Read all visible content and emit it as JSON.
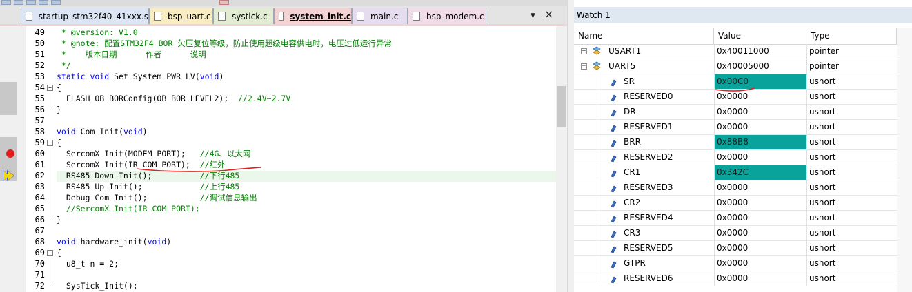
{
  "editor": {
    "tabs": [
      {
        "label": "startup_stm32f40_41xxx.s",
        "color": "#dce5f3"
      },
      {
        "label": "bsp_uart.c",
        "color": "#f7ecc2"
      },
      {
        "label": "systick.c",
        "color": "#e2ecd2"
      },
      {
        "label": "system_init.c",
        "color": "#f2d2d2"
      },
      {
        "label": "main.c",
        "color": "#e5dcf0"
      },
      {
        "label": "bsp_modem.c",
        "color": "#f0dce7"
      }
    ],
    "active_tab_index": 3,
    "menu_glyph": "▼",
    "close_glyph": "×",
    "lines": [
      {
        "num": "49",
        "text": " * @version: V1.0",
        "style": "cmt"
      },
      {
        "num": "50",
        "text": " * @note: 配置STM32F4 BOR 欠压复位等级，防止使用超级电容供电时，电压过低运行异常",
        "style": "cmt"
      },
      {
        "num": "51",
        "text": " *    版本日期      作者      说明",
        "style": "cmt"
      },
      {
        "num": "52",
        "text": " */",
        "style": "cmt"
      },
      {
        "num": "53",
        "pre": "",
        "kw1": "static void",
        "mid": " Set_System_PWR_LV(",
        "kw2": "void",
        "post": ")",
        "style": "kwline"
      },
      {
        "num": "54",
        "text": "{",
        "style": "plain"
      },
      {
        "num": "55",
        "code": "  FLASH_OB_BORConfig(OB_BOR_LEVEL2);  ",
        "comment": "//2.4V~2.7V",
        "style": "mixed"
      },
      {
        "num": "56",
        "text": "}",
        "style": "plain"
      },
      {
        "num": "57",
        "text": "",
        "style": "plain"
      },
      {
        "num": "58",
        "pre": "",
        "kw1": "void",
        "mid": " Com_Init(",
        "kw2": "void",
        "post": ")",
        "style": "kwline"
      },
      {
        "num": "59",
        "text": "{",
        "style": "plain"
      },
      {
        "num": "60",
        "code": "  SercomX_Init(MODEM_PORT);   ",
        "comment": "//4G、以太网",
        "style": "mixed"
      },
      {
        "num": "61",
        "code": "  SercomX_Init(IR_COM_PORT);  ",
        "comment": "//红外",
        "style": "mixed"
      },
      {
        "num": "62",
        "code": "  RS485_Down_Init();          ",
        "comment": "//下行485",
        "style": "mixed"
      },
      {
        "num": "63",
        "code": "  RS485_Up_Init();            ",
        "comment": "//上行485",
        "style": "mixed"
      },
      {
        "num": "64",
        "code": "  Debug_Com_Init();           ",
        "comment": "//调试信息输出",
        "style": "mixed"
      },
      {
        "num": "65",
        "text": "  //SercomX_Init(IR_COM_PORT);",
        "style": "cmt"
      },
      {
        "num": "66",
        "text": "}",
        "style": "plain"
      },
      {
        "num": "67",
        "text": "",
        "style": "plain"
      },
      {
        "num": "68",
        "pre": "",
        "kw1": "void",
        "mid": " hardware_init(",
        "kw2": "void",
        "post": ")",
        "style": "kwline"
      },
      {
        "num": "69",
        "text": "{",
        "style": "plain"
      },
      {
        "num": "70",
        "text": "  u8_t n = 2;",
        "style": "plain"
      },
      {
        "num": "71",
        "text": "",
        "style": "plain"
      },
      {
        "num": "72",
        "text": "  SysTick_Init();",
        "style": "plain"
      }
    ]
  },
  "watch": {
    "title": "Watch 1",
    "columns": {
      "name": "Name",
      "value": "Value",
      "type": "Type"
    },
    "rows": [
      {
        "name": "USART1",
        "value": "0x40011000",
        "type": "pointer",
        "kind": "struct",
        "expander": "+",
        "highlight": false
      },
      {
        "name": "UART5",
        "value": "0x40005000",
        "type": "pointer",
        "kind": "struct",
        "expander": "−",
        "highlight": false
      },
      {
        "name": "SR",
        "value": "0x00C0",
        "type": "ushort",
        "kind": "field",
        "highlight": true
      },
      {
        "name": "RESERVED0",
        "value": "0x0000",
        "type": "ushort",
        "kind": "field",
        "highlight": false
      },
      {
        "name": "DR",
        "value": "0x0000",
        "type": "ushort",
        "kind": "field",
        "highlight": false
      },
      {
        "name": "RESERVED1",
        "value": "0x0000",
        "type": "ushort",
        "kind": "field",
        "highlight": false
      },
      {
        "name": "BRR",
        "value": "0x88B8",
        "type": "ushort",
        "kind": "field",
        "highlight": true
      },
      {
        "name": "RESERVED2",
        "value": "0x0000",
        "type": "ushort",
        "kind": "field",
        "highlight": false
      },
      {
        "name": "CR1",
        "value": "0x342C",
        "type": "ushort",
        "kind": "field",
        "highlight": true
      },
      {
        "name": "RESERVED3",
        "value": "0x0000",
        "type": "ushort",
        "kind": "field",
        "highlight": false
      },
      {
        "name": "CR2",
        "value": "0x0000",
        "type": "ushort",
        "kind": "field",
        "highlight": false
      },
      {
        "name": "RESERVED4",
        "value": "0x0000",
        "type": "ushort",
        "kind": "field",
        "highlight": false
      },
      {
        "name": "CR3",
        "value": "0x0000",
        "type": "ushort",
        "kind": "field",
        "highlight": false
      },
      {
        "name": "RESERVED5",
        "value": "0x0000",
        "type": "ushort",
        "kind": "field",
        "highlight": false
      },
      {
        "name": "GTPR",
        "value": "0x0000",
        "type": "ushort",
        "kind": "field",
        "highlight": false
      },
      {
        "name": "RESERVED6",
        "value": "0x0000",
        "type": "ushort",
        "kind": "field",
        "highlight": false
      }
    ]
  },
  "colors": {
    "highlight": "#0aa39b",
    "comment": "#008000",
    "keyword": "#0000ff",
    "breakpoint": "#e41b1b",
    "annotation": "#e02020"
  },
  "icons": {
    "file": "file-icon",
    "struct": "struct-icon",
    "field": "field-icon",
    "breakpoint": "breakpoint-icon",
    "current_line": "current-line-arrow-icon",
    "expand": "expand-icon",
    "collapse": "collapse-icon"
  }
}
